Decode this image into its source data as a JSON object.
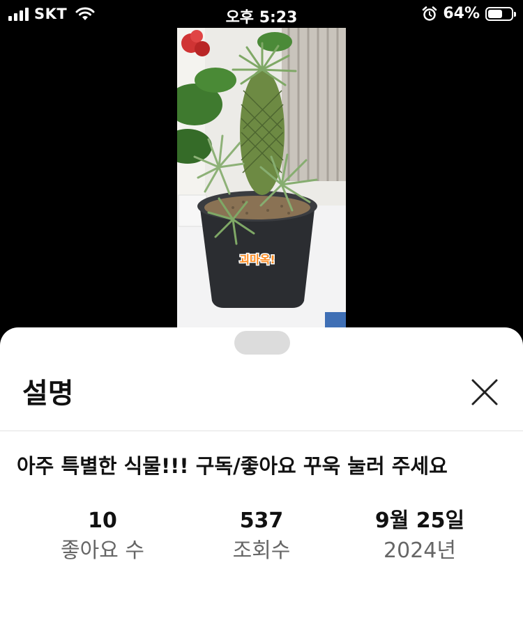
{
  "status_bar": {
    "carrier": "SKT",
    "time": "오후 5:23",
    "battery": "64%",
    "battery_level": 0.64
  },
  "video": {
    "overlay_text": "괴마옥!"
  },
  "sheet": {
    "title": "설명",
    "description": "아주 특별한 식물!!! 구독/좋아요 꾸욱 눌러 주세요",
    "stats": [
      {
        "value": "10",
        "label": "좋아요 수"
      },
      {
        "value": "537",
        "label": "조회수"
      },
      {
        "value": "9월 25일",
        "label": "2024년"
      }
    ]
  }
}
